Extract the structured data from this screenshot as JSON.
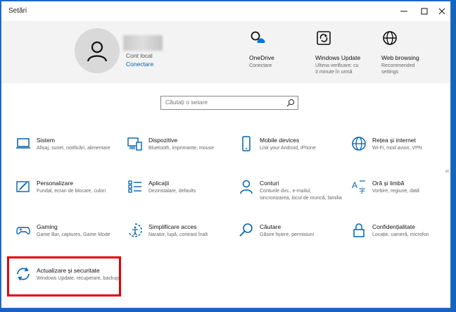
{
  "window": {
    "title": "Setări"
  },
  "account": {
    "label": "Cont local",
    "link": "Conectare"
  },
  "header_items": [
    {
      "icon": "onedrive-icon",
      "title": "OneDrive",
      "sub": [
        "Conectare"
      ]
    },
    {
      "icon": "windows-update-icon",
      "title": "Windows Update",
      "sub": [
        "Ultima verificare: cu",
        "3 minute în urmă"
      ]
    },
    {
      "icon": "globe-icon",
      "title": "Web browsing",
      "sub": [
        "Recommended",
        "settings"
      ]
    }
  ],
  "search": {
    "placeholder": "Căutați o setare"
  },
  "tiles": [
    {
      "icon": "laptop-icon",
      "title": "Sistem",
      "sub": "Afișaj, sunet, notificări, alimentare"
    },
    {
      "icon": "devices-icon",
      "title": "Dispozitive",
      "sub": "Bluetooth, imprimante, mouse"
    },
    {
      "icon": "phone-icon",
      "title": "Mobile devices",
      "sub": "Link your Android, iPhone"
    },
    {
      "icon": "network-globe-icon",
      "title": "Rețea și internet",
      "sub": "Wi-Fi, mod avion, VPN"
    },
    {
      "icon": "personalization-icon",
      "title": "Personalizare",
      "sub": "Fundal, ecran de blocare, culori"
    },
    {
      "icon": "apps-icon",
      "title": "Aplicații",
      "sub": "Dezinstalare, defaults"
    },
    {
      "icon": "person-icon",
      "title": "Conturi",
      "sub": "Conturile dvs., e-mailul, sincronizarea, locul de muncă, familia"
    },
    {
      "icon": "time-language-icon",
      "title": "Oră și limbă",
      "sub": "Vorbire, regiune, dată"
    },
    {
      "icon": "gamepad-icon",
      "title": "Gaming",
      "sub": "Game Bar, captures, Game Mode"
    },
    {
      "icon": "accessibility-icon",
      "title": "Simplificare acces",
      "sub": "Narator, lupă, contrast înalt"
    },
    {
      "icon": "search-magnifier-icon",
      "title": "Căutare",
      "sub": "Găsire fișiere, permisiuni"
    },
    {
      "icon": "lock-icon",
      "title": "Confidențialitate",
      "sub": "Locație, cameră, microfon"
    },
    {
      "icon": "sync-icon",
      "title": "Actualizare și securitate",
      "sub": "Windows Update, recuperare, backup"
    }
  ],
  "colors": {
    "accent": "#0063b1",
    "highlight": "#e3000b",
    "desktop": "#1565c0"
  }
}
